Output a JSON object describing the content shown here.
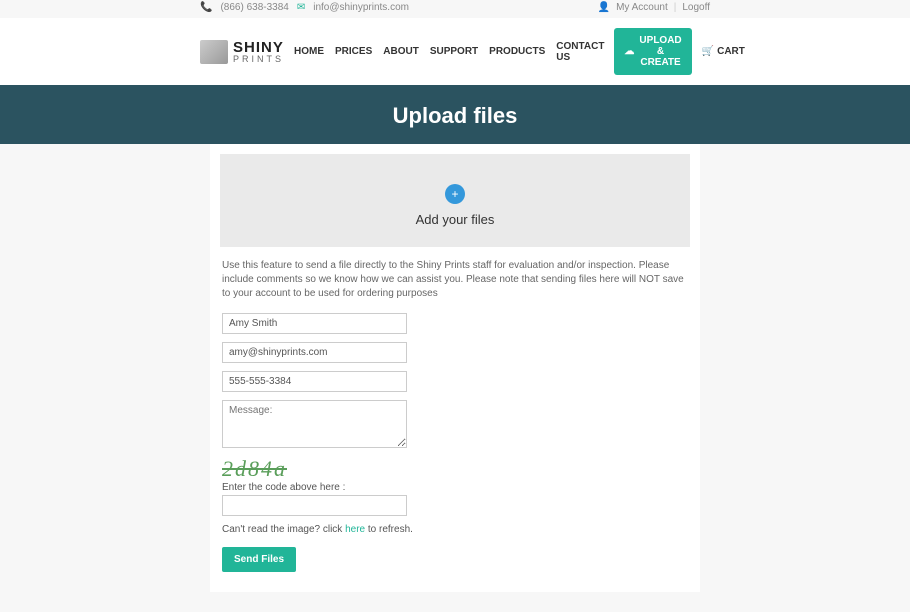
{
  "topbar": {
    "phone": "(866) 638-3384",
    "email": "info@shinyprints.com",
    "account": "My Account",
    "logoff": "Logoff"
  },
  "logo": {
    "main": "SHINY",
    "sub": "PRINTS"
  },
  "nav": {
    "items": [
      "HOME",
      "PRICES",
      "ABOUT",
      "SUPPORT",
      "PRODUCTS",
      "CONTACT US"
    ],
    "upload": "UPLOAD & CREATE",
    "cart": "CART"
  },
  "page": {
    "title": "Upload files"
  },
  "dropzone": {
    "add": "Add your files"
  },
  "instructions": "Use this feature to send a file directly to the Shiny Prints staff for evaluation and/or inspection. Please include comments so we know how we can assist you. Please note that sending files here will NOT save to your account to be used for ordering purposes",
  "form": {
    "name": "Amy Smith",
    "email": "amy@shinyprints.com",
    "phone": "555-555-3384",
    "message_placeholder": "Message:"
  },
  "captcha": {
    "code": "2d84a",
    "label": "Enter the code above here :",
    "hint_prefix": "Can't read the image? click ",
    "hint_link": "here",
    "hint_suffix": " to refresh."
  },
  "submit": "Send Files"
}
